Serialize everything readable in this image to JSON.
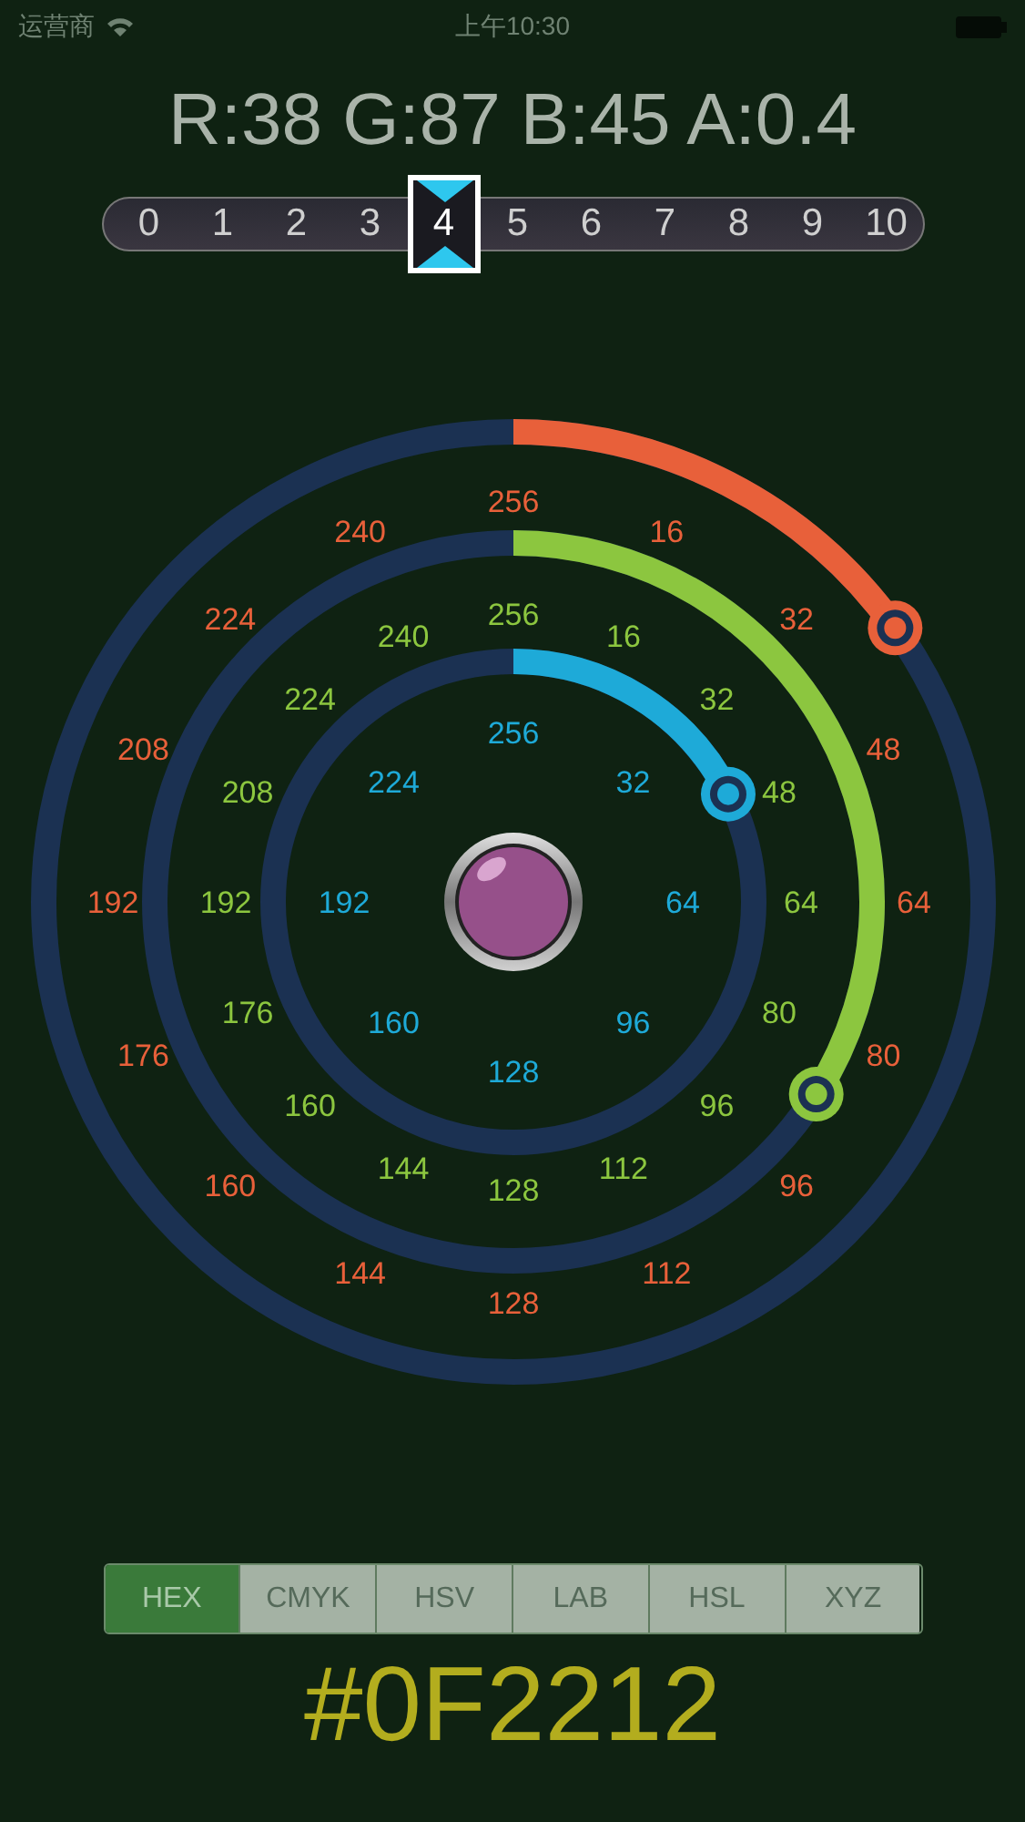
{
  "status_bar": {
    "carrier": "运营商",
    "time": "上午10:30"
  },
  "readout": "R:38 G:87 B:45 A:0.4",
  "alpha_scale": {
    "ticks": [
      {
        "label": "0",
        "selected": false
      },
      {
        "label": "1",
        "selected": false
      },
      {
        "label": "2",
        "selected": false
      },
      {
        "label": "3",
        "selected": false
      },
      {
        "label": "4",
        "selected": true
      },
      {
        "label": "5",
        "selected": false
      },
      {
        "label": "6",
        "selected": false
      },
      {
        "label": "7",
        "selected": false
      },
      {
        "label": "8",
        "selected": false
      },
      {
        "label": "9",
        "selected": false
      },
      {
        "label": "10",
        "selected": false
      }
    ]
  },
  "dial": {
    "rings": [
      {
        "color": "#e8603a",
        "labels": [
          "256",
          "16",
          "32",
          "48",
          "64",
          "80",
          "96",
          "112",
          "128",
          "144",
          "160",
          "176",
          "192",
          "208",
          "224",
          "240"
        ]
      },
      {
        "color": "#8cc63f",
        "labels": [
          "256",
          "16",
          "32",
          "48",
          "64",
          "80",
          "96",
          "112",
          "128",
          "144",
          "160",
          "176",
          "192",
          "208",
          "224",
          "240"
        ]
      },
      {
        "color": "#1eaad8",
        "labels": [
          "256",
          "32",
          "64",
          "96",
          "128",
          "160",
          "192",
          "224"
        ]
      }
    ]
  },
  "tabs": [
    {
      "label": "HEX",
      "selected": true
    },
    {
      "label": "CMYK",
      "selected": false
    },
    {
      "label": "HSV",
      "selected": false
    },
    {
      "label": "LAB",
      "selected": false
    },
    {
      "label": "HSL",
      "selected": false
    },
    {
      "label": "XYZ",
      "selected": false
    }
  ],
  "value": "#0F2212"
}
